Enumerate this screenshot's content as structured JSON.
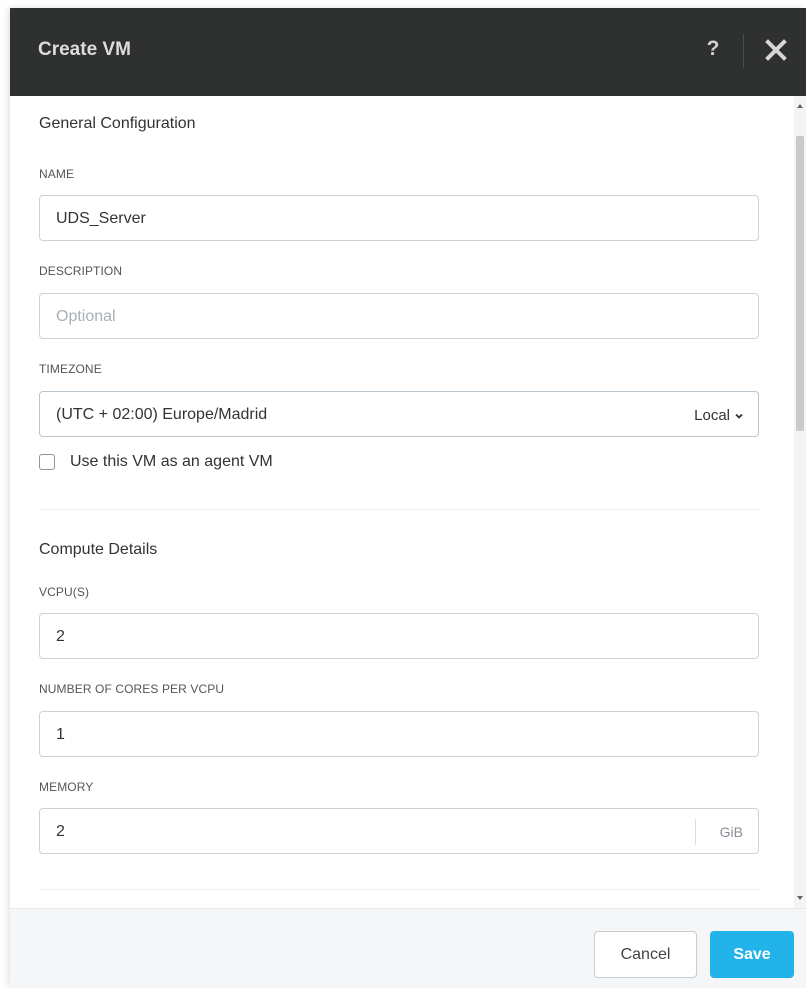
{
  "dialog": {
    "title": "Create VM",
    "help_label": "?",
    "close_icon": "close-icon"
  },
  "general": {
    "section_title": "General Configuration",
    "name_label": "NAME",
    "name_value": "UDS_Server",
    "description_label": "DESCRIPTION",
    "description_placeholder": "Optional",
    "timezone_label": "TIMEZONE",
    "timezone_value": "(UTC + 02:00) Europe/Madrid",
    "timezone_mode": "Local",
    "agent_vm_label": "Use this VM as an agent VM",
    "agent_vm_checked": false
  },
  "compute": {
    "section_title": "Compute Details",
    "vcpus_label": "VCPU(S)",
    "vcpus_value": "2",
    "cores_label": "NUMBER OF CORES PER VCPU",
    "cores_value": "1",
    "memory_label": "MEMORY",
    "memory_value": "2",
    "memory_unit": "GiB"
  },
  "footer": {
    "cancel_label": "Cancel",
    "save_label": "Save"
  },
  "colors": {
    "header_bg": "#2f3130",
    "save_bg": "#22b3ea",
    "border": "#cfd3d6"
  }
}
